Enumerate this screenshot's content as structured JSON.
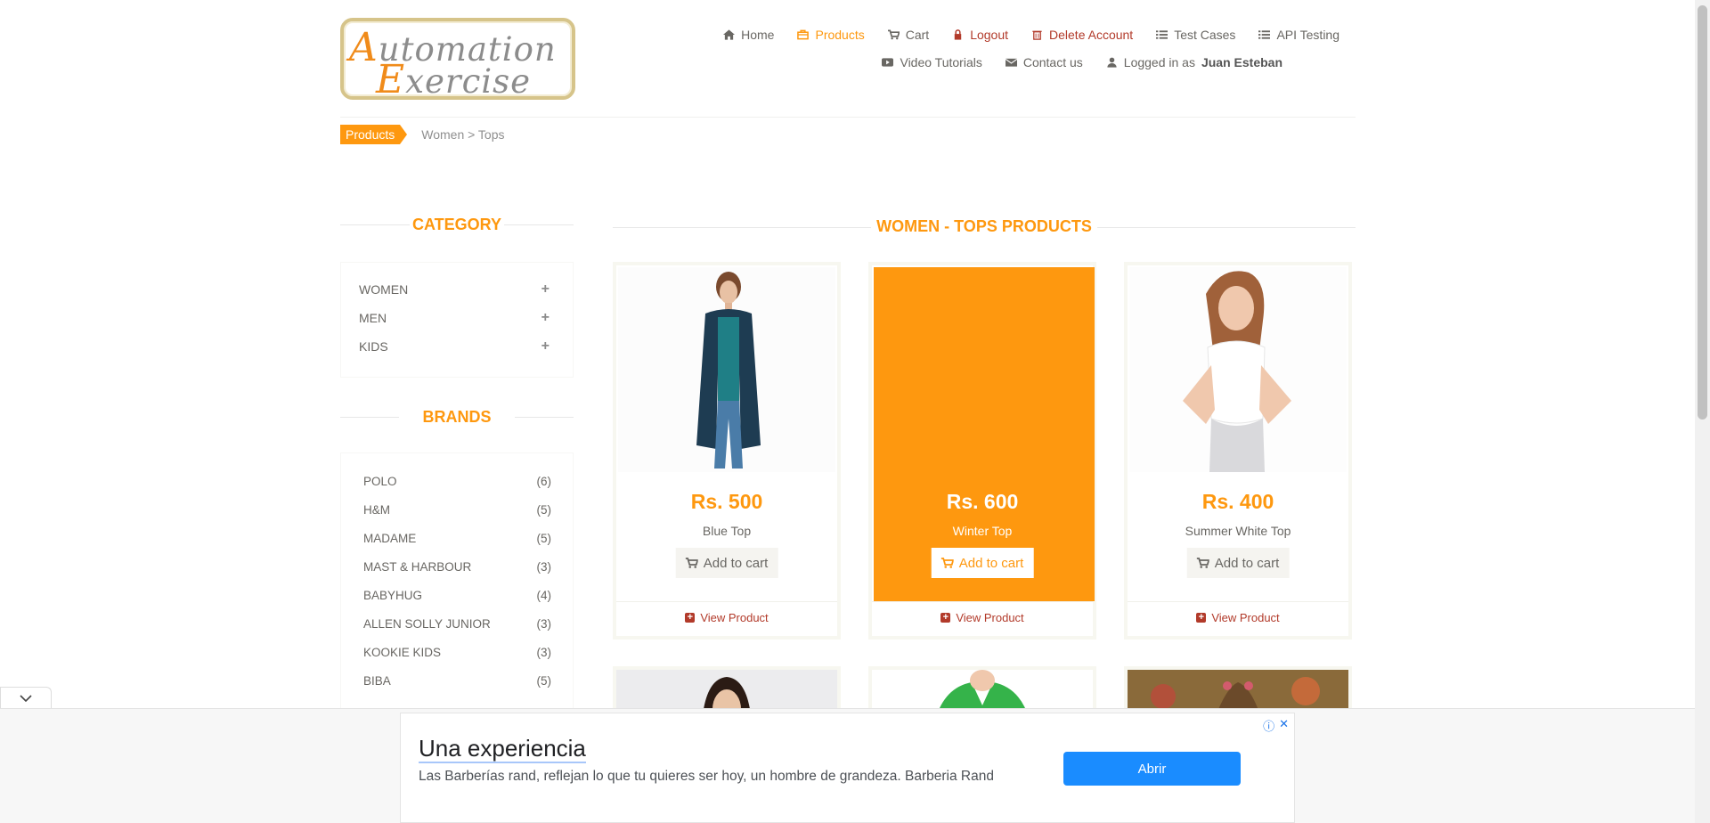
{
  "header": {
    "logo_line1_cap": "A",
    "logo_line1_rest": "utomation",
    "logo_line2_cap": "E",
    "logo_line2_rest": "xercise",
    "nav_row1": [
      {
        "label": "Home",
        "icon": "home-icon"
      },
      {
        "label": "Products",
        "icon": "shopping-bag-icon",
        "active": true
      },
      {
        "label": "Cart",
        "icon": "cart-icon"
      },
      {
        "label": "Logout",
        "icon": "lock-icon"
      },
      {
        "label": "Delete Account",
        "icon": "trash-icon"
      },
      {
        "label": "Test Cases",
        "icon": "list-icon"
      },
      {
        "label": "API Testing",
        "icon": "list-icon"
      }
    ],
    "nav_row2": [
      {
        "label": "Video Tutorials",
        "icon": "youtube-play-icon"
      },
      {
        "label": "Contact us",
        "icon": "envelope-icon"
      },
      {
        "label": "Logged in as",
        "icon": "user-icon"
      }
    ],
    "username": "Juan Esteban"
  },
  "breadcrumb": {
    "tag": "Products",
    "path": "Women > Tops"
  },
  "sidebar": {
    "category_title": "CATEGORY",
    "categories": [
      {
        "label": "WOMEN",
        "toggle": "+"
      },
      {
        "label": "MEN",
        "toggle": "+"
      },
      {
        "label": "KIDS",
        "toggle": "+"
      }
    ],
    "brands_title": "BRANDS",
    "brands": [
      {
        "label": "POLO",
        "count": "(6)"
      },
      {
        "label": "H&M",
        "count": "(5)"
      },
      {
        "label": "MADAME",
        "count": "(5)"
      },
      {
        "label": "MAST & HARBOUR",
        "count": "(3)"
      },
      {
        "label": "BABYHUG",
        "count": "(4)"
      },
      {
        "label": "ALLEN SOLLY JUNIOR",
        "count": "(3)"
      },
      {
        "label": "KOOKIE KIDS",
        "count": "(3)"
      },
      {
        "label": "BIBA",
        "count": "(5)"
      }
    ]
  },
  "main": {
    "title": "WOMEN - TOPS PRODUCTS",
    "products": [
      {
        "price": "Rs. 500",
        "name": "Blue Top",
        "cart_label": "Add to cart",
        "view_label": "View Product"
      },
      {
        "price": "Rs. 600",
        "name": "Winter Top",
        "cart_label": "Add to cart",
        "view_label": "View Product"
      },
      {
        "price": "Rs. 400",
        "name": "Summer White Top",
        "cart_label": "Add to cart",
        "view_label": "View Product"
      }
    ]
  },
  "ad": {
    "title": "Una experiencia",
    "description": "Las Barberías rand, reflejan lo que tu quieres ser hoy, un hombre de grandeza. Barberia Rand",
    "button": "Abrir",
    "info_icon": "ⓘ",
    "close_icon": "✕"
  },
  "colors": {
    "accent": "#FE980F",
    "danger": "#B23A2A",
    "ad_button": "#1A8CFF"
  }
}
